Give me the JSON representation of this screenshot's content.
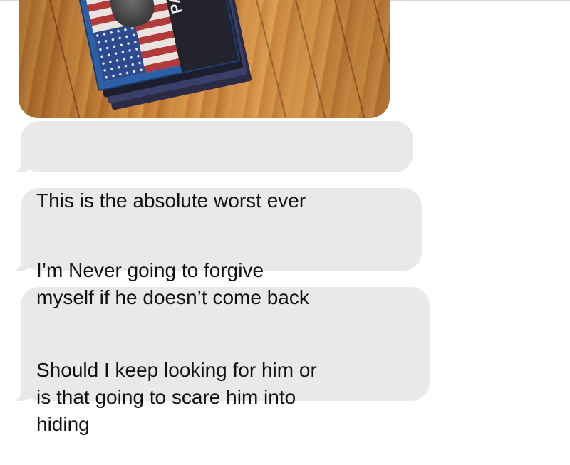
{
  "messages": [
    {
      "type": "image",
      "description_icon": "photo-attachment",
      "cover_text": "PATTON"
    },
    {
      "type": "text",
      "direction": "incoming",
      "text": "This is the absolute worst ever"
    },
    {
      "type": "text",
      "direction": "incoming",
      "text": "I’m Never going to forgive\nmyself if he doesn’t come back"
    },
    {
      "type": "text",
      "direction": "incoming",
      "text": "Should I keep looking for him or\nis that going to scare him into\nhiding"
    }
  ],
  "colors": {
    "incoming_bubble": "#e9e9eb",
    "message_text": "#111111",
    "background": "#ffffff"
  }
}
